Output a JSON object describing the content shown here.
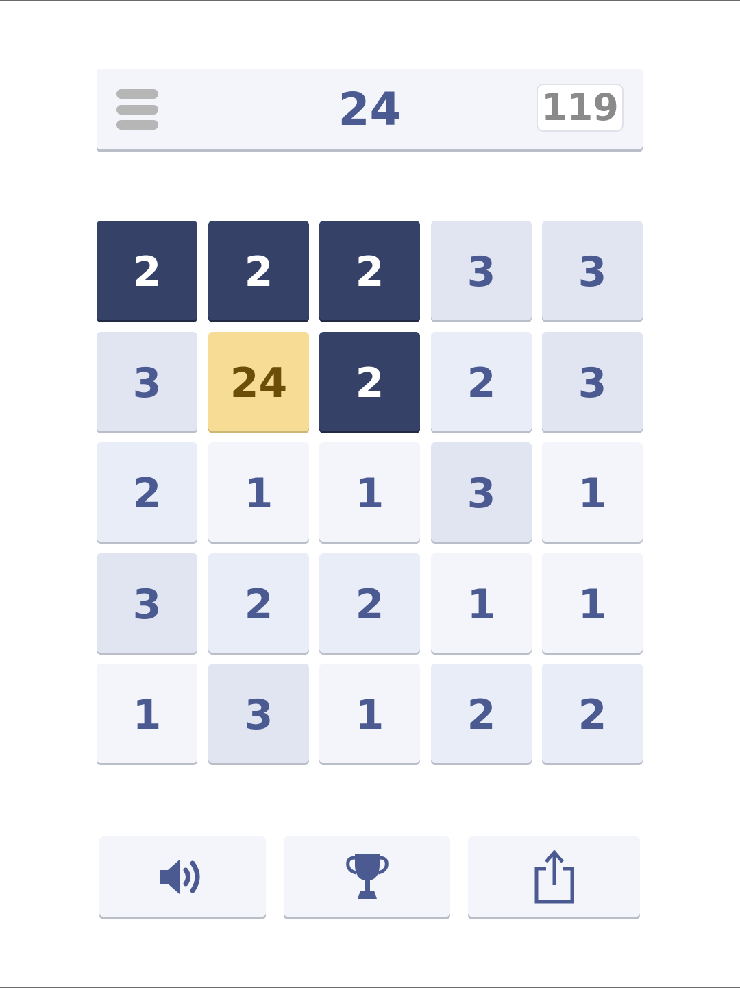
{
  "header": {
    "target_number": "24",
    "moves_count": "119",
    "menu_icon": "hamburger-menu-icon"
  },
  "board": {
    "rows": [
      [
        {
          "value": "2",
          "state": "selected"
        },
        {
          "value": "2",
          "state": "selected"
        },
        {
          "value": "2",
          "state": "selected"
        },
        {
          "value": "3",
          "state": "normal"
        },
        {
          "value": "3",
          "state": "normal"
        }
      ],
      [
        {
          "value": "3",
          "state": "normal"
        },
        {
          "value": "24",
          "state": "target"
        },
        {
          "value": "2",
          "state": "selected"
        },
        {
          "value": "2",
          "state": "normal"
        },
        {
          "value": "3",
          "state": "normal"
        }
      ],
      [
        {
          "value": "2",
          "state": "normal"
        },
        {
          "value": "1",
          "state": "normal"
        },
        {
          "value": "1",
          "state": "normal"
        },
        {
          "value": "3",
          "state": "normal"
        },
        {
          "value": "1",
          "state": "normal"
        }
      ],
      [
        {
          "value": "3",
          "state": "normal"
        },
        {
          "value": "2",
          "state": "normal"
        },
        {
          "value": "2",
          "state": "normal"
        },
        {
          "value": "1",
          "state": "normal"
        },
        {
          "value": "1",
          "state": "normal"
        }
      ],
      [
        {
          "value": "1",
          "state": "normal"
        },
        {
          "value": "3",
          "state": "normal"
        },
        {
          "value": "1",
          "state": "normal"
        },
        {
          "value": "2",
          "state": "normal"
        },
        {
          "value": "2",
          "state": "normal"
        }
      ]
    ]
  },
  "footer": {
    "buttons": [
      {
        "icon": "speaker-icon"
      },
      {
        "icon": "trophy-icon"
      },
      {
        "icon": "share-icon"
      }
    ]
  },
  "colors": {
    "accent": "#4b5b92",
    "selected_tile": "#354167",
    "target_tile": "#f6dc95",
    "target_text": "#6c4e08"
  }
}
